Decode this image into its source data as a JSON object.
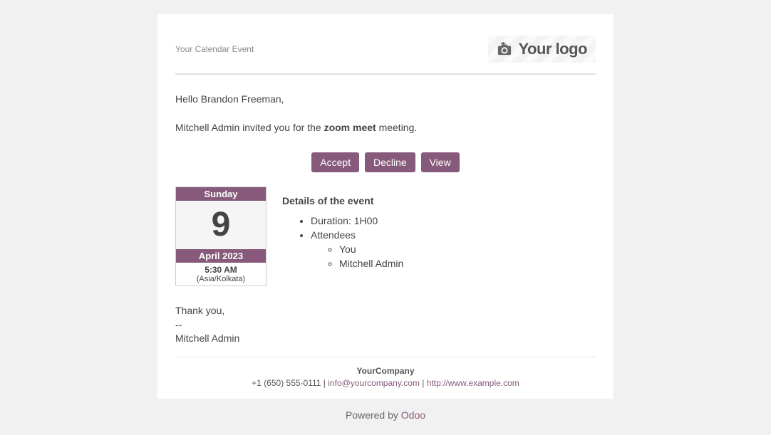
{
  "header": {
    "title": "Your Calendar Event",
    "logo_text": "Your logo"
  },
  "greeting_prefix": "Hello ",
  "recipient_name": "Brandon Freeman",
  "greeting_suffix": ",",
  "inviter": "Mitchell Admin",
  "invite_mid": " invited you for the ",
  "meeting_name": "zoom meet",
  "invite_suffix": " meeting.",
  "buttons": {
    "accept": "Accept",
    "decline": "Decline",
    "view": "View"
  },
  "date": {
    "day_name": "Sunday",
    "day_num": "9",
    "month_year": "April 2023",
    "time": "5:30 AM",
    "timezone": "(Asia/Kolkata)"
  },
  "details": {
    "heading": "Details of the event",
    "duration": "Duration: 1H00",
    "attendees_label": "Attendees",
    "attendees": {
      "you": "You",
      "other": "Mitchell Admin"
    }
  },
  "thanks": "Thank you,",
  "dash": "--",
  "signature": "Mitchell Admin",
  "footer": {
    "company": "YourCompany",
    "phone": "+1 (650) 555-0111",
    "sep": " | ",
    "email": "info@yourcompany.com",
    "url": "http://www.example.com"
  },
  "powered_prefix": "Powered by ",
  "powered_link": "Odoo"
}
